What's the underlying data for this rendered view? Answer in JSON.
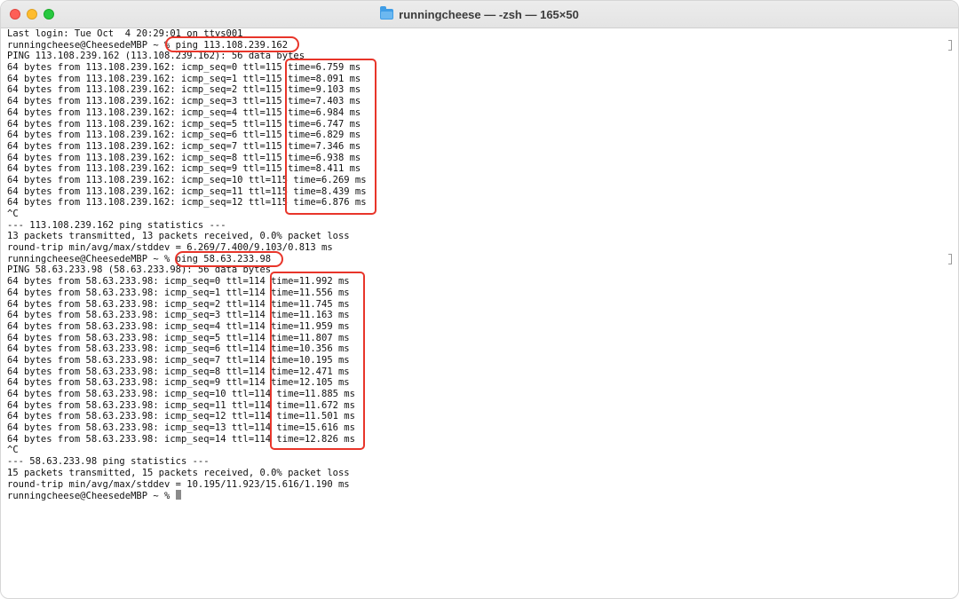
{
  "window": {
    "title": "runningcheese — -zsh — 165×50",
    "title_icon": "folder-icon",
    "traffic_lights": [
      "close",
      "minimize",
      "zoom"
    ]
  },
  "terminal": {
    "lines": [
      "Last login: Tue Oct  4 20:29:01 on ttys001",
      "runningcheese@CheesedeMBP ~ % ping 113.108.239.162",
      "PING 113.108.239.162 (113.108.239.162): 56 data bytes",
      "64 bytes from 113.108.239.162: icmp_seq=0 ttl=115 time=6.759 ms",
      "64 bytes from 113.108.239.162: icmp_seq=1 ttl=115 time=8.091 ms",
      "64 bytes from 113.108.239.162: icmp_seq=2 ttl=115 time=9.103 ms",
      "64 bytes from 113.108.239.162: icmp_seq=3 ttl=115 time=7.403 ms",
      "64 bytes from 113.108.239.162: icmp_seq=4 ttl=115 time=6.984 ms",
      "64 bytes from 113.108.239.162: icmp_seq=5 ttl=115 time=6.747 ms",
      "64 bytes from 113.108.239.162: icmp_seq=6 ttl=115 time=6.829 ms",
      "64 bytes from 113.108.239.162: icmp_seq=7 ttl=115 time=7.346 ms",
      "64 bytes from 113.108.239.162: icmp_seq=8 ttl=115 time=6.938 ms",
      "64 bytes from 113.108.239.162: icmp_seq=9 ttl=115 time=8.411 ms",
      "64 bytes from 113.108.239.162: icmp_seq=10 ttl=115 time=6.269 ms",
      "64 bytes from 113.108.239.162: icmp_seq=11 ttl=115 time=8.439 ms",
      "64 bytes from 113.108.239.162: icmp_seq=12 ttl=115 time=6.876 ms",
      "^C",
      "--- 113.108.239.162 ping statistics ---",
      "13 packets transmitted, 13 packets received, 0.0% packet loss",
      "round-trip min/avg/max/stddev = 6.269/7.400/9.103/0.813 ms",
      "runningcheese@CheesedeMBP ~ % ping 58.63.233.98",
      "PING 58.63.233.98 (58.63.233.98): 56 data bytes",
      "64 bytes from 58.63.233.98: icmp_seq=0 ttl=114 time=11.992 ms",
      "64 bytes from 58.63.233.98: icmp_seq=1 ttl=114 time=11.556 ms",
      "64 bytes from 58.63.233.98: icmp_seq=2 ttl=114 time=11.745 ms",
      "64 bytes from 58.63.233.98: icmp_seq=3 ttl=114 time=11.163 ms",
      "64 bytes from 58.63.233.98: icmp_seq=4 ttl=114 time=11.959 ms",
      "64 bytes from 58.63.233.98: icmp_seq=5 ttl=114 time=11.807 ms",
      "64 bytes from 58.63.233.98: icmp_seq=6 ttl=114 time=10.356 ms",
      "64 bytes from 58.63.233.98: icmp_seq=7 ttl=114 time=10.195 ms",
      "64 bytes from 58.63.233.98: icmp_seq=8 ttl=114 time=12.471 ms",
      "64 bytes from 58.63.233.98: icmp_seq=9 ttl=114 time=12.105 ms",
      "64 bytes from 58.63.233.98: icmp_seq=10 ttl=114 time=11.885 ms",
      "64 bytes from 58.63.233.98: icmp_seq=11 ttl=114 time=11.672 ms",
      "64 bytes from 58.63.233.98: icmp_seq=12 ttl=114 time=11.501 ms",
      "64 bytes from 58.63.233.98: icmp_seq=13 ttl=114 time=15.616 ms",
      "64 bytes from 58.63.233.98: icmp_seq=14 ttl=114 time=12.826 ms",
      "^C",
      "--- 58.63.233.98 ping statistics ---",
      "15 packets transmitted, 15 packets received, 0.0% packet loss",
      "round-trip min/avg/max/stddev = 10.195/11.923/15.616/1.190 ms",
      "runningcheese@CheesedeMBP ~ % "
    ]
  },
  "colors": {
    "highlight": "#e8352a",
    "close": "#fe5f57",
    "minimize": "#febc2e",
    "zoom": "#28c840"
  }
}
